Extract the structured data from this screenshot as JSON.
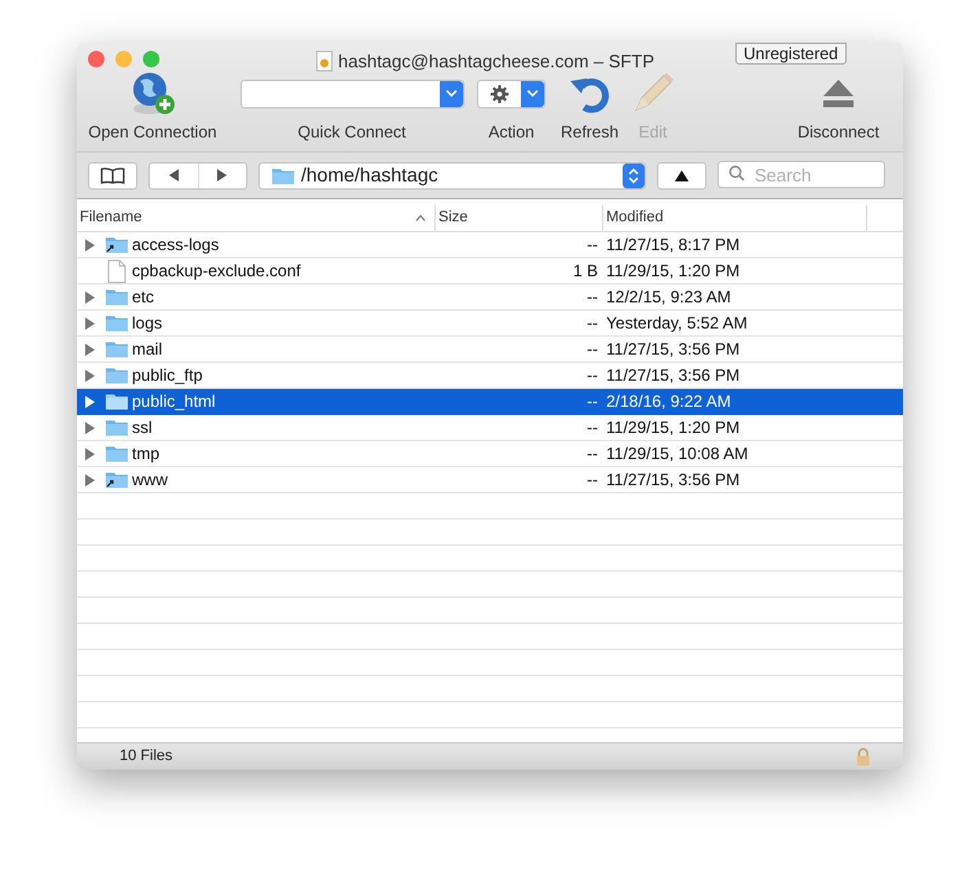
{
  "window": {
    "title": "hashtagc@hashtagcheese.com – SFTP",
    "badge": "Unregistered"
  },
  "toolbar": [
    {
      "kind": "open",
      "label": "Open Connection",
      "disabled": false
    },
    {
      "kind": "combo",
      "label": "Quick Connect",
      "disabled": false
    },
    {
      "kind": "action",
      "label": "Action",
      "disabled": false
    },
    {
      "kind": "refresh",
      "label": "Refresh",
      "disabled": false
    },
    {
      "kind": "edit",
      "label": "Edit",
      "disabled": true
    },
    {
      "kind": "disconnect",
      "label": "Disconnect",
      "disabled": false
    }
  ],
  "path_bar": {
    "path": "/home/hashtagc",
    "search_placeholder": "Search"
  },
  "table": {
    "columns": [
      "Filename",
      "Size",
      "Modified"
    ],
    "rows": [
      {
        "kind": "folder",
        "alias": true,
        "name": "access-logs",
        "size": "--",
        "modified": "11/27/15, 8:17 PM",
        "selected": false
      },
      {
        "kind": "file",
        "name": "cpbackup-exclude.conf",
        "size": "1 B",
        "modified": "11/29/15, 1:20 PM",
        "selected": false
      },
      {
        "kind": "folder",
        "alias": false,
        "name": "etc",
        "size": "--",
        "modified": "12/2/15, 9:23 AM",
        "selected": false
      },
      {
        "kind": "folder",
        "alias": false,
        "name": "logs",
        "size": "--",
        "modified": "Yesterday, 5:52 AM",
        "selected": false
      },
      {
        "kind": "folder",
        "alias": false,
        "name": "mail",
        "size": "--",
        "modified": "11/27/15, 3:56 PM",
        "selected": false
      },
      {
        "kind": "folder",
        "alias": false,
        "name": "public_ftp",
        "size": "--",
        "modified": "11/27/15, 3:56 PM",
        "selected": false
      },
      {
        "kind": "folder",
        "alias": false,
        "name": "public_html",
        "size": "--",
        "modified": "2/18/16, 9:22 AM",
        "selected": true
      },
      {
        "kind": "folder",
        "alias": false,
        "name": "ssl",
        "size": "--",
        "modified": "11/29/15, 1:20 PM",
        "selected": false
      },
      {
        "kind": "folder",
        "alias": false,
        "name": "tmp",
        "size": "--",
        "modified": "11/29/15, 10:08 AM",
        "selected": false
      },
      {
        "kind": "folder",
        "alias": true,
        "name": "www",
        "size": "--",
        "modified": "11/27/15, 3:56 PM",
        "selected": false
      }
    ]
  },
  "status_bar": {
    "text": "10 Files"
  }
}
